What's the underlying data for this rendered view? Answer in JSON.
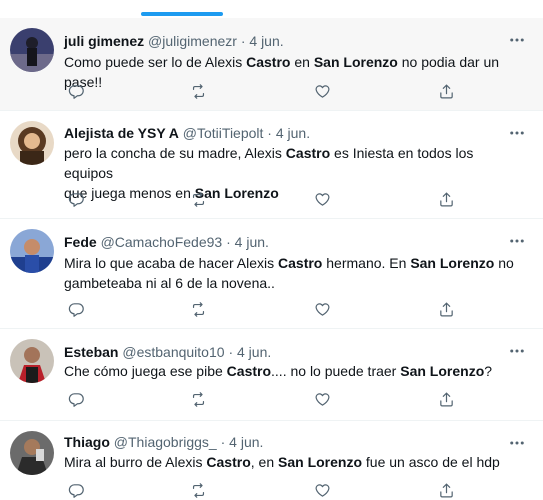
{
  "colors": {
    "accent": "#1d9bf0",
    "text": "#0f1419",
    "secondary": "#536471",
    "hover_bg": "#f7f7f7"
  },
  "icons": {
    "reply": "reply-icon",
    "retweet": "retweet-icon",
    "like": "like-icon",
    "share": "share-icon",
    "more": "more-icon"
  },
  "tweets": [
    {
      "name": "juli gimenez",
      "handle": "@juligimenezr",
      "dot": "·",
      "date": "4 jun.",
      "lines": [
        {
          "segments": [
            {
              "t": "Como puede ser lo de Alexis "
            },
            {
              "t": "Castro",
              "b": true
            },
            {
              "t": " en "
            },
            {
              "t": "San Lorenzo",
              "b": true
            },
            {
              "t": " no podia dar un pase!!"
            }
          ]
        }
      ]
    },
    {
      "name": "Alejista de YSY A",
      "handle": "@TotiiTiepolt",
      "dot": "·",
      "date": "4 jun.",
      "lines": [
        {
          "segments": [
            {
              "t": "pero la concha de su madre, Alexis "
            },
            {
              "t": "Castro",
              "b": true
            },
            {
              "t": " es Iniesta en todos los equipos"
            }
          ]
        },
        {
          "segments": [
            {
              "t": "que juega menos en "
            },
            {
              "t": "San Lorenzo",
              "b": true
            }
          ]
        }
      ]
    },
    {
      "name": "Fede",
      "handle": "@CamachoFede93",
      "dot": "·",
      "date": "4 jun.",
      "lines": [
        {
          "segments": [
            {
              "t": "Mira lo que acaba de hacer Alexis "
            },
            {
              "t": "Castro",
              "b": true
            },
            {
              "t": " hermano. En "
            },
            {
              "t": "San Lorenzo",
              "b": true
            },
            {
              "t": " no"
            }
          ]
        },
        {
          "segments": [
            {
              "t": "gambeteaba ni al 6 de la novena.."
            }
          ]
        }
      ]
    },
    {
      "name": "Esteban",
      "handle": "@estbanquito10",
      "dot": "·",
      "date": "4 jun.",
      "lines": [
        {
          "segments": [
            {
              "t": "Che cómo juega ese pibe "
            },
            {
              "t": "Castro",
              "b": true
            },
            {
              "t": ".... no lo puede traer "
            },
            {
              "t": "San Lorenzo",
              "b": true
            },
            {
              "t": "?"
            }
          ]
        }
      ]
    },
    {
      "name": "Thiago",
      "handle": "@Thiagobriggs_",
      "dot": "·",
      "date": "4 jun.",
      "lines": [
        {
          "segments": [
            {
              "t": "Mira al burro de Alexis "
            },
            {
              "t": "Castro",
              "b": true
            },
            {
              "t": ", en "
            },
            {
              "t": "San Lorenzo",
              "b": true
            },
            {
              "t": " fue un asco de el hdp"
            }
          ]
        }
      ]
    }
  ]
}
